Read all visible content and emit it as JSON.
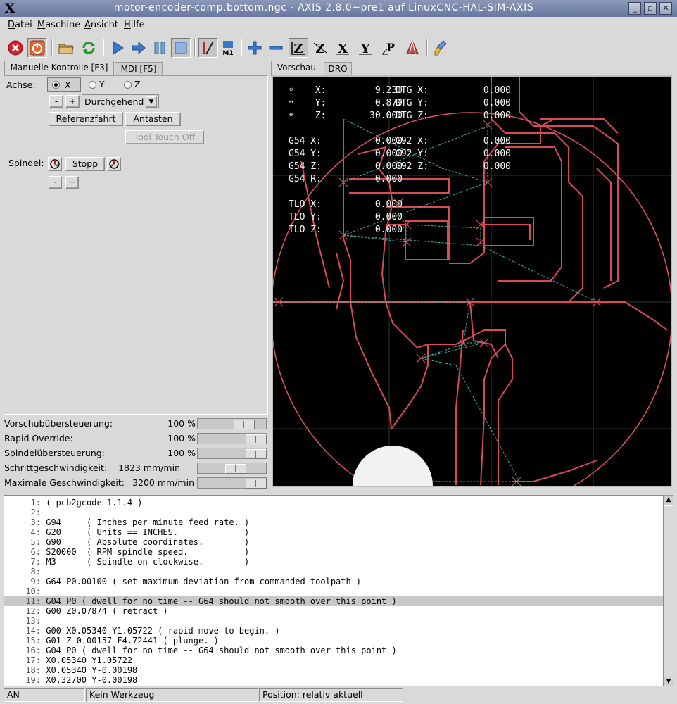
{
  "window": {
    "icon": "X",
    "title": "motor-encoder-comp.bottom.ngc - AXIS 2.8.0~pre1 auf  LinuxCNC-HAL-SIM-AXIS",
    "buttons": [
      "_",
      "▫",
      "✕"
    ]
  },
  "menu": [
    {
      "label": "Datei",
      "mnemonic": "D",
      "rest": "atei"
    },
    {
      "label": "Maschine",
      "mnemonic": "M",
      "rest": "aschine"
    },
    {
      "label": "Ansicht",
      "mnemonic": "A",
      "rest": "nsicht"
    },
    {
      "label": "Hilfe",
      "mnemonic": "H",
      "rest": "ilfe"
    }
  ],
  "toolbar": {
    "icons": [
      "estop-icon",
      "machine-power-icon",
      "open-file-icon",
      "reload-icon",
      "run-icon",
      "step-icon",
      "pause-icon",
      "stop-icon",
      "block-delete-icon",
      "optional-stop-icon",
      "zoom-in-icon",
      "zoom-out-icon",
      "view-z-icon",
      "view-z2-icon",
      "view-x-icon",
      "view-y-icon",
      "view-p-icon",
      "rotate-view-icon",
      "clear-plot-icon"
    ],
    "m1_label": "M1"
  },
  "left_tabs": [
    "Manuelle Kontrolle [F3]",
    "MDI [F5]"
  ],
  "right_tabs": [
    "Vorschau",
    "DRO"
  ],
  "manual": {
    "axis_label": "Achse:",
    "axes": [
      "X",
      "Y",
      "Z"
    ],
    "selected_axis": "X",
    "minus": "-",
    "plus": "+",
    "jog_mode": "Durchgehend",
    "home_button": "Referenzfahrt",
    "touch_button": "Antasten",
    "tool_touch_off": "Tool Touch Off",
    "spindle_label": "Spindel:",
    "spindle_stop": "Stopp",
    "spindle_minus": "-",
    "spindle_plus": "+"
  },
  "overrides": [
    {
      "label": "Vorschubübersteuerung:",
      "value": "100 %",
      "level": 0.75
    },
    {
      "label": "Rapid Override:",
      "value": "100 %",
      "level": 1.0
    },
    {
      "label": "Spindelübersteuerung:",
      "value": "100 %",
      "level": 1.0
    },
    {
      "label": "Schrittgeschwindigkeit:",
      "value": "1823 mm/min",
      "level": 0.57
    },
    {
      "label": "Maximale Geschwindigkeit:",
      "value": "3200 mm/min",
      "level": 1.0
    }
  ],
  "dro": {
    "rows": [
      {
        "label": " X:",
        "value": "9.230",
        "dtg": "DTG X:",
        "dtg_value": "0.000"
      },
      {
        "label": " Y:",
        "value": "0.879",
        "dtg": "DTG Y:",
        "dtg_value": "0.000"
      },
      {
        "label": " Z:",
        "value": "30.000",
        "dtg": "DTG Z:",
        "dtg_value": "0.000"
      }
    ],
    "g_rows": [
      {
        "label": "G54 X:",
        "value": "0.000",
        "g2": "G92 X:",
        "g2_value": "0.000"
      },
      {
        "label": "G54 Y:",
        "value": "0.000",
        "g2": "G92 Y:",
        "g2_value": "0.000"
      },
      {
        "label": "G54 Z:",
        "value": "0.000",
        "g2": "G92 Z:",
        "g2_value": "0.000"
      },
      {
        "label": "G54 R:",
        "value": "0.000",
        "g2": "",
        "g2_value": ""
      }
    ],
    "tlo_rows": [
      {
        "label": "TLO X:",
        "value": "0.000"
      },
      {
        "label": "TLO Y:",
        "value": "0.000"
      },
      {
        "label": "TLO Z:",
        "value": "0.000"
      }
    ]
  },
  "code": [
    {
      "n": "1:",
      "text": "( pcb2gcode 1.1.4 )"
    },
    {
      "n": "2:",
      "text": ""
    },
    {
      "n": "3:",
      "text": "G94     ( Inches per minute feed rate. )"
    },
    {
      "n": "4:",
      "text": "G20     ( Units == INCHES.             )"
    },
    {
      "n": "5:",
      "text": "G90     ( Absolute coordinates.        )"
    },
    {
      "n": "6:",
      "text": "S20000  ( RPM spindle speed.           )"
    },
    {
      "n": "7:",
      "text": "M3      ( Spindle on clockwise.        )"
    },
    {
      "n": "8:",
      "text": ""
    },
    {
      "n": "9:",
      "text": "G64 P0.00100 ( set maximum deviation from commanded toolpath )"
    },
    {
      "n": "10:",
      "text": ""
    },
    {
      "n": "11:",
      "text": "G04 P0 ( dwell for no time -- G64 should not smooth over this point )"
    },
    {
      "n": "12:",
      "text": "G00 Z0.07874 ( retract )"
    },
    {
      "n": "13:",
      "text": ""
    },
    {
      "n": "14:",
      "text": "G00 X0.05340 Y1.05722 ( rapid move to begin. )"
    },
    {
      "n": "15:",
      "text": "G01 Z-0.00157 F4.72441 ( plunge. )"
    },
    {
      "n": "16:",
      "text": "G04 P0 ( dwell for no time -- G64 should not smooth over this point )"
    },
    {
      "n": "17:",
      "text": "X0.05340 Y1.05722"
    },
    {
      "n": "18:",
      "text": "X0.05340 Y-0.00198"
    },
    {
      "n": "19:",
      "text": "X0.32700 Y-0.00198"
    }
  ],
  "selected_line": "11:",
  "status": [
    "AN",
    "Kein Werkzeug",
    "Position: relativ aktuell"
  ]
}
